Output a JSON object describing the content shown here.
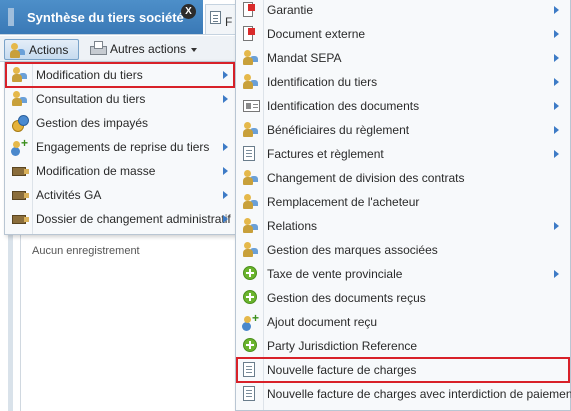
{
  "app": {
    "active_tab": "Synthèse du tiers société",
    "close_glyph": "X",
    "second_tab": "F",
    "empty_text": "Aucun enregistrement"
  },
  "toolbar": {
    "actions_label": "Actions",
    "other_actions_label": "Autres actions"
  },
  "actions_menu": {
    "items": [
      {
        "label": "Modification du tiers",
        "icon": "users-icon",
        "submenu": true,
        "highlighted": true
      },
      {
        "label": "Consultation du tiers",
        "icon": "users-icon",
        "submenu": true
      },
      {
        "label": "Gestion des impayés",
        "icon": "coins-icon",
        "submenu": false
      },
      {
        "label": "Engagements de reprise du tiers",
        "icon": "user-plus-icon",
        "submenu": true
      },
      {
        "label": "Modification de masse",
        "icon": "truck-icon",
        "submenu": true
      },
      {
        "label": "Activités GA",
        "icon": "truck-icon",
        "submenu": true
      },
      {
        "label": "Dossier de changement administratif",
        "icon": "truck-icon",
        "submenu": true
      }
    ]
  },
  "submenu": {
    "items": [
      {
        "label": "Garantie",
        "icon": "flag-icon",
        "submenu": true
      },
      {
        "label": "Document externe",
        "icon": "flag-icon",
        "submenu": true
      },
      {
        "label": "Mandat SEPA",
        "icon": "users-icon",
        "submenu": true
      },
      {
        "label": "Identification du tiers",
        "icon": "users-icon",
        "submenu": true
      },
      {
        "label": "Identification des documents",
        "icon": "card-icon",
        "submenu": true
      },
      {
        "label": "Bénéficiaires du règlement",
        "icon": "users-icon",
        "submenu": true
      },
      {
        "label": "Factures et règlement",
        "icon": "document-icon",
        "submenu": true
      },
      {
        "label": "Changement de division des contrats",
        "icon": "users-icon",
        "submenu": false
      },
      {
        "label": "Remplacement de l'acheteur",
        "icon": "users-icon",
        "submenu": false
      },
      {
        "label": "Relations",
        "icon": "users-icon",
        "submenu": true
      },
      {
        "label": "Gestion des marques associées",
        "icon": "users-icon",
        "submenu": false
      },
      {
        "label": "Taxe de vente provinciale",
        "icon": "plus-circle-icon",
        "submenu": true
      },
      {
        "label": "Gestion des documents reçus",
        "icon": "plus-circle-icon",
        "submenu": false
      },
      {
        "label": "Ajout document reçu",
        "icon": "user-plus-icon",
        "submenu": false
      },
      {
        "label": "Party Jurisdiction Reference",
        "icon": "plus-circle-icon",
        "submenu": false
      },
      {
        "label": "Nouvelle facture de charges",
        "icon": "document-icon",
        "submenu": false,
        "highlighted": true
      },
      {
        "label": "Nouvelle facture de charges avec interdiction de paiement",
        "icon": "document-icon",
        "submenu": false
      }
    ]
  },
  "colors": {
    "tab_active": "#3a79b6",
    "highlight": "#d82129",
    "arrow": "#3d7bc6"
  }
}
